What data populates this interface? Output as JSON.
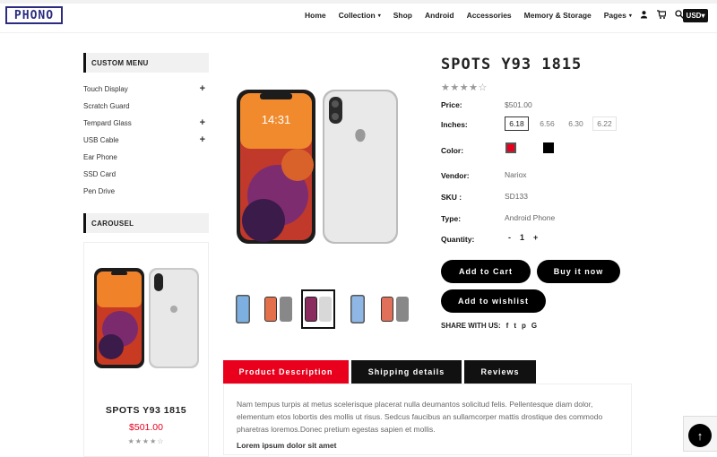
{
  "header": {
    "logo_text": "PHONO",
    "nav": [
      {
        "label": "Home",
        "caret": ""
      },
      {
        "label": "Collection",
        "caret": "▾"
      },
      {
        "label": "Shop",
        "caret": ""
      },
      {
        "label": "Android",
        "caret": ""
      },
      {
        "label": "Accessories",
        "caret": ""
      },
      {
        "label": "Memory & Storage",
        "caret": ""
      },
      {
        "label": "Pages",
        "caret": "▾"
      }
    ],
    "icons": [
      "user-icon",
      "cart-icon",
      "search-icon"
    ],
    "currency": "USD▾"
  },
  "sidebar": {
    "custom_menu_title": "CUSTOM MENU",
    "menu": [
      {
        "label": "Touch Display",
        "expand": "+"
      },
      {
        "label": "Scratch Guard",
        "expand": ""
      },
      {
        "label": "Tempard Glass",
        "expand": "+"
      },
      {
        "label": "USB Cable",
        "expand": "+"
      },
      {
        "label": "Ear Phone",
        "expand": ""
      },
      {
        "label": "SSD Card",
        "expand": ""
      },
      {
        "label": "Pen Drive",
        "expand": ""
      }
    ],
    "carousel_title": "CAROUSEL",
    "carousel_item": {
      "name": "SPOTS Y93 1815",
      "price": "$501.00",
      "stars": "★★★★☆"
    }
  },
  "product": {
    "title": "SPOTS Y93 1815",
    "stars": "★★★★☆",
    "price_label": "Price:",
    "price": "$501.00",
    "inches_label": "Inches:",
    "sizes": [
      "6.18",
      "6.56",
      "6.30",
      "6.22"
    ],
    "selected_size": "6.18",
    "color_label": "Color:",
    "colors": [
      "#e8001c",
      "#000000"
    ],
    "vendor_label": "Vendor:",
    "vendor": "Nariox",
    "sku_label": "SKU :",
    "sku": "SD133",
    "type_label": "Type:",
    "type": "Android Phone",
    "quantity_label": "Quantity:",
    "qty_minus": "-",
    "quantity": "1",
    "qty_plus": "+",
    "add_to_cart": "Add to Cart",
    "buy_now": "Buy it now",
    "add_to_wishlist": "Add to wishlist",
    "share_label": "SHARE WITH US:",
    "share_icons": [
      "f",
      "t",
      "p",
      "G"
    ]
  },
  "tabs": {
    "items": [
      "Product Description",
      "Shipping details",
      "Reviews"
    ],
    "active": "Product Description",
    "description": "Nam tempus turpis at metus scelerisque placerat nulla deumantos solicitud felis. Pellentesque diam dolor, elementum etos lobortis des mollis ut risus. Sedcus faucibus an sullamcorper mattis drostique des commodo pharetras loremos.Donec pretium egestas sapien et mollis.",
    "description_heading": "Lorem ipsum dolor sit amet"
  },
  "misc": {
    "scroll_top": "↑"
  }
}
